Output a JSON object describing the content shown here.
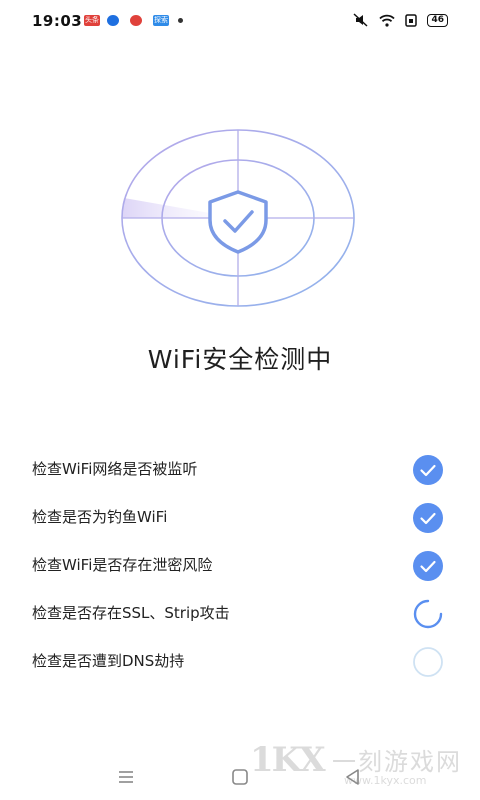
{
  "status_bar": {
    "time": "19:03",
    "notifications": [
      "头条",
      "",
      "",
      "探索"
    ],
    "battery": "46"
  },
  "icons": {
    "shield": "shield-check-icon",
    "checked": "check-circle-icon",
    "loading": "spinner-icon",
    "pending": "empty-circle-icon"
  },
  "colors": {
    "accent": "#5a8ff0",
    "ring": "#a8a9ec",
    "pending": "#cfe2f3"
  },
  "title": "WiFi安全检测中",
  "checks": [
    {
      "label": "检查WiFi网络是否被监听",
      "status": "done"
    },
    {
      "label": "检查是否为钓鱼WiFi",
      "status": "done"
    },
    {
      "label": "检查WiFi是否存在泄密风险",
      "status": "done"
    },
    {
      "label": "检查是否存在SSL、Strip攻击",
      "status": "loading"
    },
    {
      "label": "检查是否遭到DNS劫持",
      "status": "pending"
    }
  ],
  "watermark": {
    "logo": "1KX",
    "name": "一刻游戏网",
    "url": "www.1kyx.com"
  }
}
